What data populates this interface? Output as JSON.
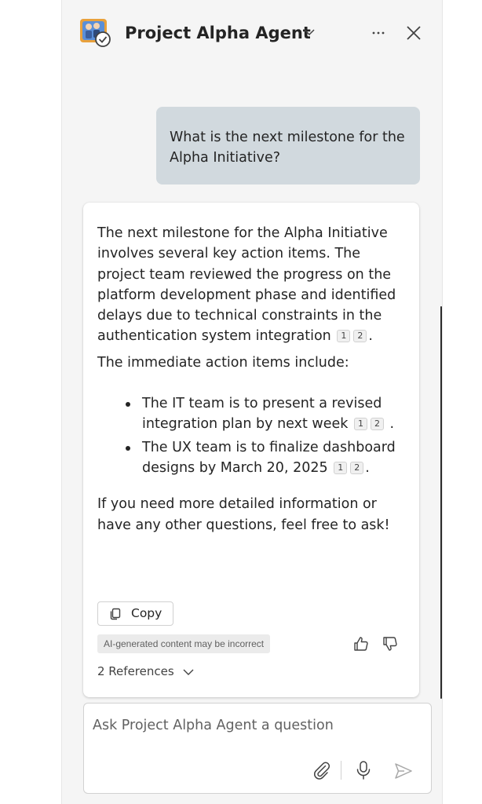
{
  "header": {
    "title": "Project Alpha Agent",
    "avatar_icon": "agent-avatar-icon",
    "chevron_icon": "chevron-down-icon",
    "more_icon": "more-horizontal-icon",
    "close_icon": "close-icon"
  },
  "user_message": {
    "text": "What is the next milestone for the Alpha Initiative?"
  },
  "response": {
    "paragraph1": "The next milestone for the Alpha Initiative involves several key action items. The project team reviewed the progress on the platform development phase and identified delays due to technical constraints in the authentication system integration",
    "paragraph2": "The immediate action items include:",
    "bullets": [
      {
        "text": "The IT team is to present a revised integration plan by next week"
      },
      {
        "text": "The UX team is to finalize dashboard designs by March 20, 2025"
      }
    ],
    "paragraph3": "If you need more detailed information or have any other questions, feel free to ask!",
    "citations": [
      "1",
      "2"
    ],
    "copy_label": "Copy",
    "disclaimer": "AI-generated content may be incorrect",
    "references_label": "2 References"
  },
  "input": {
    "placeholder": "Ask Project Alpha Agent a question",
    "value": ""
  },
  "colors": {
    "panel_bg": "#f5f5f5",
    "user_bubble": "#d1d9de",
    "card_bg": "#ffffff",
    "text": "#242424"
  }
}
